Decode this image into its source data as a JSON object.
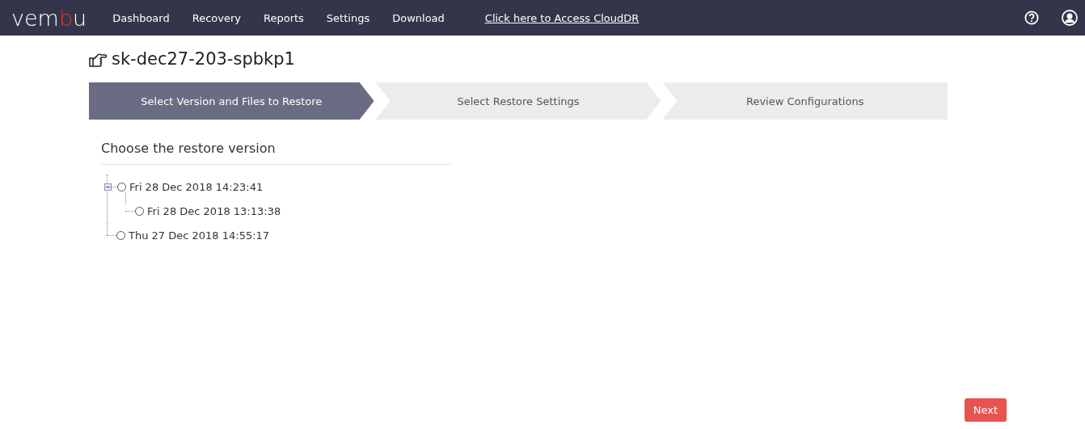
{
  "navbar": {
    "logo": [
      {
        "text": "vem",
        "accent": false
      },
      {
        "text": "b",
        "accent": true
      },
      {
        "text": "u",
        "accent": false
      }
    ],
    "menu": [
      {
        "label": "Dashboard"
      },
      {
        "label": "Recovery"
      },
      {
        "label": "Reports"
      },
      {
        "label": "Settings"
      },
      {
        "label": "Download"
      }
    ],
    "cloud_link": "Click here to Access CloudDR"
  },
  "page_title": "sk-dec27-203-spbkp1",
  "steps": [
    {
      "label": "Select Version and Files to Restore",
      "selected": true
    },
    {
      "label": "Select Restore Settings",
      "selected": false
    },
    {
      "label": "Review Configurations",
      "selected": false
    }
  ],
  "section_title": "Choose the restore version",
  "versions": [
    {
      "label": "Fri 28 Dec 2018 14:23:41",
      "checked": false,
      "expanded": true,
      "children": [
        {
          "label": "Fri 28 Dec 2018 13:13:38",
          "checked": false
        }
      ]
    },
    {
      "label": "Thu 27 Dec 2018 14:55:17",
      "checked": false
    }
  ],
  "next_button": "Next"
}
